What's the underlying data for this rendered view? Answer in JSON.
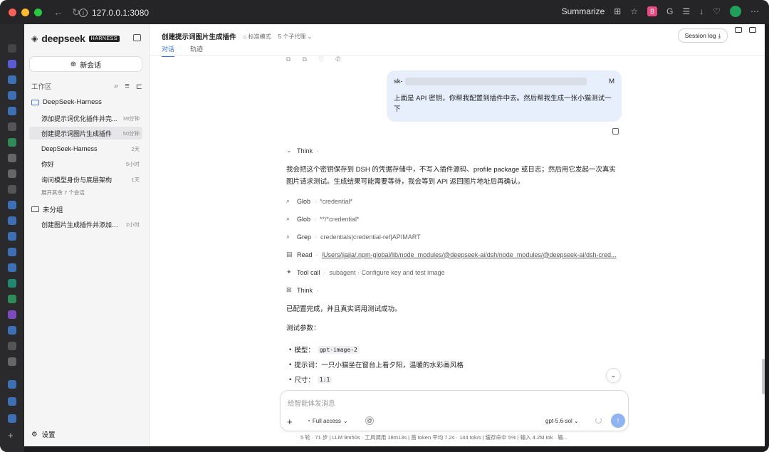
{
  "browser": {
    "url": "127.0.0.1:3080",
    "summarize": "Summarize",
    "traffic_colors": [
      "#fe5f57",
      "#febc2e",
      "#28c840"
    ]
  },
  "sidebar": {
    "brand": "deepseek",
    "tag": "HARNESS",
    "new_chat": "新会话",
    "workspace": "工作区",
    "groups": [
      {
        "label": "DeepSeek-Harness"
      },
      {
        "label": "未分组"
      }
    ],
    "items": [
      {
        "label": "添加提示词优化插件并完...",
        "time": "39分钟"
      },
      {
        "label": "创建提示词图片生成插件",
        "time": "50分钟"
      },
      {
        "label": "DeepSeek-Harness",
        "time": "2天"
      },
      {
        "label": "你好",
        "time": "5小时"
      },
      {
        "label": "询问模型身份与底层架构",
        "time": "1天"
      },
      {
        "label": "创建图片生成插件并添加设...",
        "time": "2小时"
      }
    ],
    "more": "展开其余 7 个会话",
    "settings": "设置"
  },
  "header": {
    "title": "创建提示词图片生成插件",
    "mode": "标准模式",
    "subagents": "5 个子代理",
    "tabs": [
      "对话",
      "轨迹"
    ],
    "session_log": "Session log"
  },
  "user_message": {
    "key_prefix": "sk-",
    "key_suffix": "M",
    "text": "上面是 API 密钥，你帮我配置到插件中去。然后帮我生成一张小猫测试一下"
  },
  "assistant": {
    "think_label": "Think",
    "intro": "我会把这个密钥保存到 DSH 的凭据存储中，不写入插件源码、profile package 或日志；然后用它发起一次真实图片请求测试。生成结果可能需要等待，我会等到 API 返回图片地址后再确认。",
    "tools": [
      {
        "icon": "search-icon",
        "name": "Glob",
        "arg": "*credential*"
      },
      {
        "icon": "search-icon",
        "name": "Glob",
        "arg": "**/*credential*"
      },
      {
        "icon": "search-icon",
        "name": "Grep",
        "arg": "credentials|credential-ref|APIMART"
      },
      {
        "icon": "document-icon",
        "name": "Read",
        "arg": "/Users/jiajia/.npm-global/lib/node_modules/@deepseek-ai/dsh/node_modules/@deepseek-ai/dsh-cred..."
      },
      {
        "icon": "sparkle-icon",
        "name": "Tool call",
        "arg": "subagent · Configure key and test image"
      }
    ],
    "think2": "Think",
    "done": "已配置完成，并且真实调用测试成功。",
    "params_title": "测试参数：",
    "params": [
      {
        "label": "模型：",
        "value": "gpt-image-2"
      },
      {
        "label": "提示词：一只小猫坐在窗台上看夕阳，温暖的水彩画风格",
        "value": ""
      },
      {
        "label": "尺寸：",
        "value": "1:1"
      }
    ]
  },
  "composer": {
    "placeholder": "给智能体发消息",
    "access": "Full access",
    "model": "gpt-5.6-sol"
  },
  "status": "5 轮 · 71 步  |  LLM 9m50s · 工具调用 18m13s  |  首 token 平均 7.2s · 144 tok/s  |  缓存命中 5%  |  输入 4.2M tok · 输..."
}
